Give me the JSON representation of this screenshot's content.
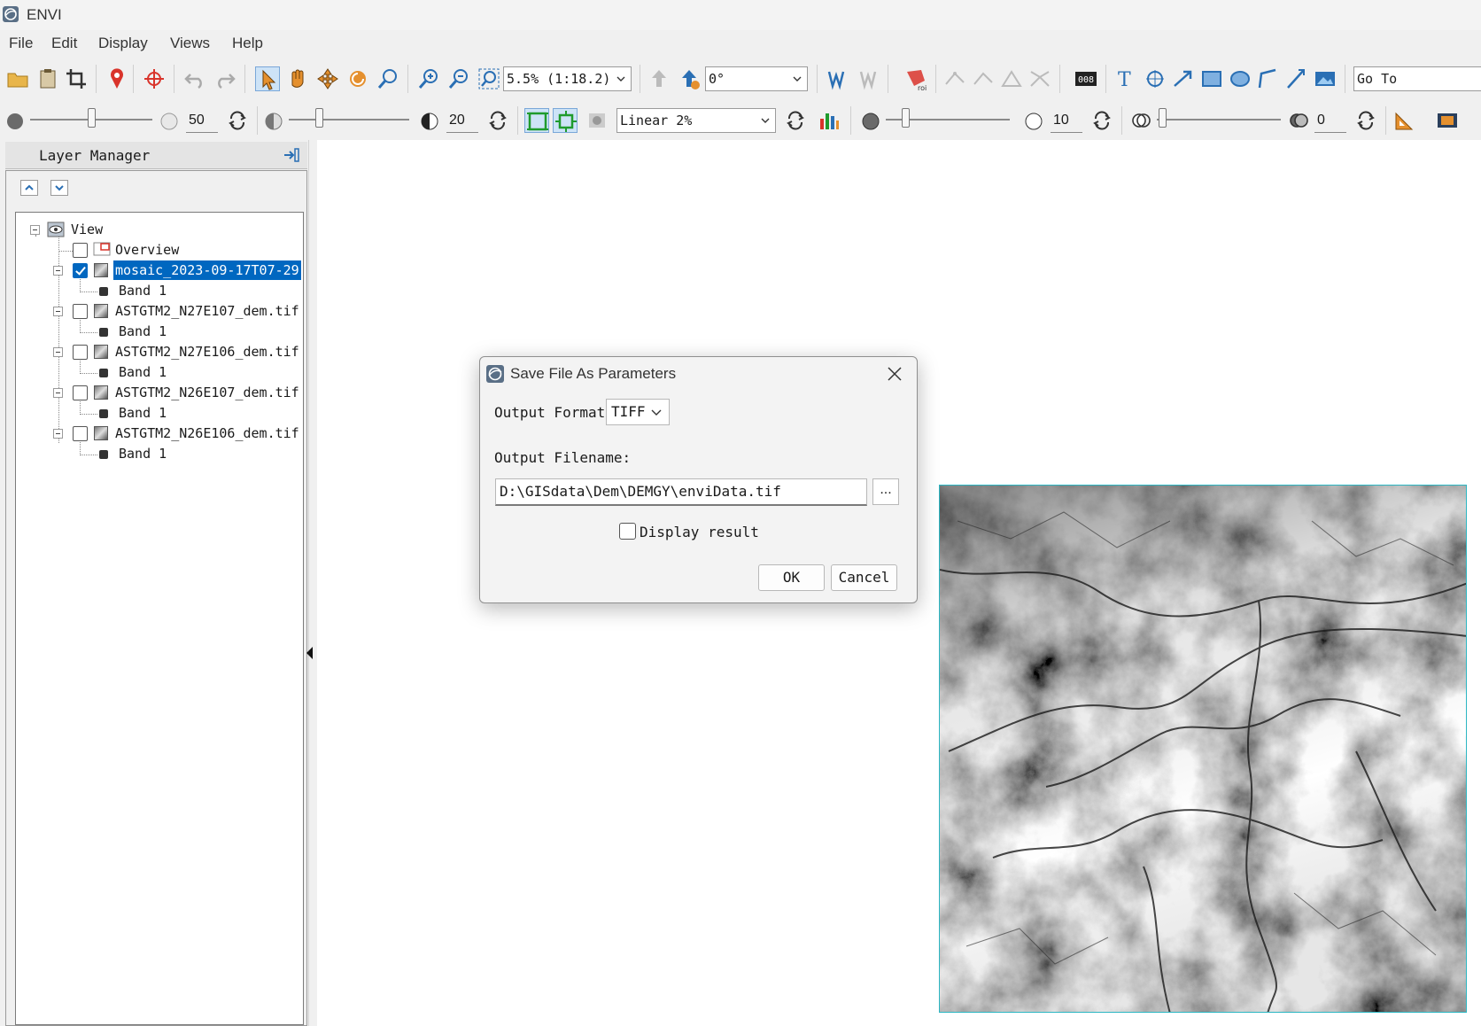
{
  "window": {
    "title": "ENVI"
  },
  "menu": [
    "File",
    "Edit",
    "Display",
    "Views",
    "Help"
  ],
  "toolbar1": {
    "zoom_value": "5.5% (1:18.2)",
    "rotation_value": "0°",
    "goto_placeholder": "Go To"
  },
  "toolbar2": {
    "brightness_value": "50",
    "contrast_value": "20",
    "stretch_value": "Linear 2%",
    "sharpen_value": "10",
    "transparency_value": "0"
  },
  "layer_manager": {
    "title": "Layer Manager",
    "tree": {
      "root": "View",
      "overview": "Overview",
      "layers": [
        {
          "name": "mosaic_2023-09-17T07-29",
          "band": "Band 1",
          "checked": true,
          "selected": true
        },
        {
          "name": "ASTGTM2_N27E107_dem.tif",
          "band": "Band 1",
          "checked": false,
          "selected": false
        },
        {
          "name": "ASTGTM2_N27E106_dem.tif",
          "band": "Band 1",
          "checked": false,
          "selected": false
        },
        {
          "name": "ASTGTM2_N26E107_dem.tif",
          "band": "Band 1",
          "checked": false,
          "selected": false
        },
        {
          "name": "ASTGTM2_N26E106_dem.tif",
          "band": "Band 1",
          "checked": false,
          "selected": false
        }
      ]
    }
  },
  "dialog": {
    "title": "Save File As Parameters",
    "output_format_label": "Output Format",
    "output_format_value": "TIFF",
    "output_filename_label": "Output Filename:",
    "output_filename_value": "D:\\GISdata\\Dem\\DEMGY\\enviData.tif",
    "browse_label": "...",
    "display_result_label": "Display result",
    "display_result_checked": false,
    "ok_label": "OK",
    "cancel_label": "Cancel"
  },
  "colors": {
    "selection": "#0067c0",
    "image_border": "#2bb6c2",
    "toolbar_icon_blue": "#2a6fb4",
    "toolbar_icon_red": "#d9342b",
    "toolbar_icon_orange": "#e5902e"
  }
}
